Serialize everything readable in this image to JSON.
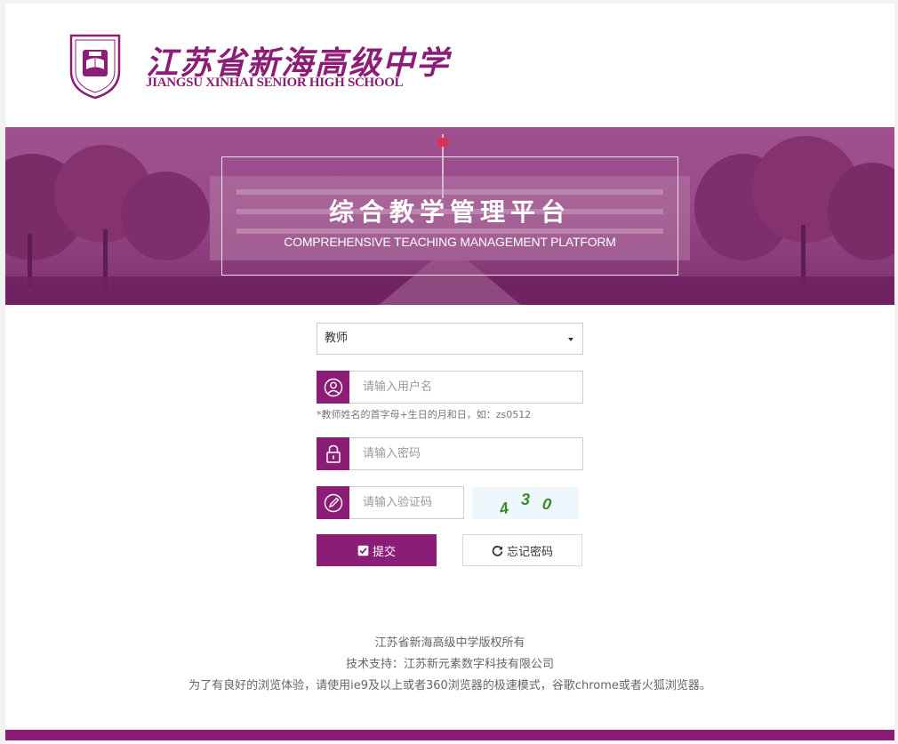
{
  "header": {
    "school_name_cn": "江苏省新海高级中学",
    "school_name_en": "JIANGSU XINHAI SENIOR HIGH SCHOOL",
    "emblem_icon": "school-emblem-icon"
  },
  "banner": {
    "title_cn": "综合教学管理平台",
    "title_en": "COMPREHENSIVE TEACHING MANAGEMENT PLATFORM"
  },
  "form": {
    "role_select": {
      "selected": "教师"
    },
    "username": {
      "placeholder": "请输入用户名",
      "value": "",
      "icon": "user-icon"
    },
    "username_hint": "*教师姓名的首字母+生日的月和日，如：zs0512",
    "password": {
      "placeholder": "请输入密码",
      "value": "",
      "icon": "lock-icon"
    },
    "captcha": {
      "placeholder": "请输入验证码",
      "value": "",
      "icon": "pencil-icon",
      "chars": [
        "4",
        "3",
        "0"
      ]
    },
    "submit_label": "提交",
    "forgot_label": "忘记密码"
  },
  "footer": {
    "copyright": "江苏省新海高级中学版权所有",
    "support": "技术支持：江苏新元素数字科技有限公司",
    "browser_tip": "为了有良好的浏览体验，请使用ie9及以上或者360浏览器的极速模式，谷歌chrome或者火狐浏览器。"
  },
  "colors": {
    "brand": "#8c1d76",
    "banner_overlay": "#9a4b8b",
    "captcha_text": "#3a8a2c"
  }
}
